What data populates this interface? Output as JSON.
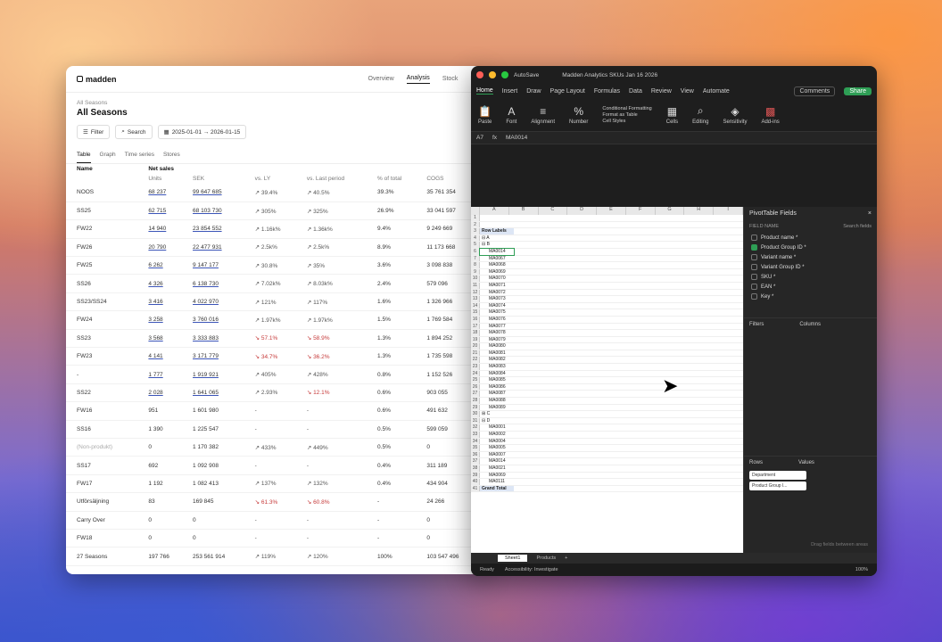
{
  "left": {
    "brand": "madden",
    "nav": [
      "Overview",
      "Analysis",
      "Stock",
      "P"
    ],
    "crumb": "All Seasons",
    "title": "All Seasons",
    "filter_label": "Filter",
    "search_label": "Search",
    "date_range": "2025-01-01 → 2026-01-15",
    "tabs": [
      "Table",
      "Graph",
      "Time series",
      "Stores"
    ],
    "header": {
      "name": "Name",
      "group": "Net sales",
      "units": "Units",
      "sek": "SEK",
      "vsly": "vs. LY",
      "vslp": "vs. Last period",
      "pct": "% of total",
      "cogs": "COGS"
    },
    "rows": [
      [
        "NOOS",
        "68 237",
        "99 647 685",
        "↗ 39.4%",
        "↗ 40.5%",
        "39.3%",
        "35 761 354"
      ],
      [
        "SS25",
        "62 715",
        "68 103 730",
        "↗ 305%",
        "↗ 325%",
        "26.9%",
        "33 041 597"
      ],
      [
        "FW22",
        "14 940",
        "23 854 552",
        "↗ 1.16k%",
        "↗ 1.36k%",
        "9.4%",
        "9 249 669"
      ],
      [
        "FW26",
        "20 790",
        "22 477 931",
        "↗ 2.5k%",
        "↗ 2.5k%",
        "8.9%",
        "11 173 668"
      ],
      [
        "FW25",
        "6 262",
        "9 147 177",
        "↗ 30.8%",
        "↗ 35%",
        "3.6%",
        "3 098 838"
      ],
      [
        "SS26",
        "4 326",
        "6 138 730",
        "↗ 7.02k%",
        "↗ 8.03k%",
        "2.4%",
        "579 096"
      ],
      [
        "SS23/SS24",
        "3 416",
        "4 022 970",
        "↗ 121%",
        "↗ 117%",
        "1.6%",
        "1 326 966"
      ],
      [
        "FW24",
        "3 258",
        "3 760 016",
        "↗ 1.97k%",
        "↗ 1.97k%",
        "1.5%",
        "1 769 584"
      ],
      [
        "SS23",
        "3 568",
        "3 333 883",
        "↘ 57.1%",
        "↘ 58.9%",
        "1.3%",
        "1 894 252"
      ],
      [
        "FW23",
        "4 141",
        "3 171 779",
        "↘ 34.7%",
        "↘ 36.2%",
        "1.3%",
        "1 735 598"
      ],
      [
        "-",
        "1 777",
        "1 919 921",
        "↗ 405%",
        "↗ 428%",
        "0.8%",
        "1 152 526"
      ],
      [
        "SS22",
        "2 028",
        "1 641 065",
        "↗ 2.93%",
        "↘ 12.1%",
        "0.6%",
        "903 055"
      ],
      [
        "FW16",
        "951",
        "1 601 980",
        "-",
        "-",
        "0.6%",
        "491 632"
      ],
      [
        "SS16",
        "1 390",
        "1 225 547",
        "-",
        "-",
        "0.5%",
        "599 059"
      ],
      [
        "(Non-produkt)",
        "0",
        "1 170 382",
        "↗ 433%",
        "↗ 449%",
        "0.5%",
        "0"
      ],
      [
        "SS17",
        "692",
        "1 092 908",
        "-",
        "-",
        "0.4%",
        "311 189"
      ],
      [
        "FW17",
        "1 192",
        "1 082 413",
        "↗ 137%",
        "↗ 132%",
        "0.4%",
        "434 904"
      ],
      [
        "Utförsäljning",
        "83",
        "169 845",
        "↘ 61.3%",
        "↘ 60.8%",
        "-",
        "24 266"
      ],
      [
        "Carry Over",
        "0",
        "0",
        "-",
        "-",
        "-",
        "0"
      ],
      [
        "FW18",
        "0",
        "0",
        "-",
        "-",
        "-",
        "0"
      ],
      [
        "27 Seasons",
        "197 766",
        "253 561 914",
        "↗ 119%",
        "↗ 120%",
        "100%",
        "103 547 496"
      ]
    ]
  },
  "right": {
    "autosave": "AutoSave",
    "doc_title": "Madden Analytics SKUs Jan 16 2026",
    "ribbon_tabs": [
      "Home",
      "Insert",
      "Draw",
      "Page Layout",
      "Formulas",
      "Data",
      "Review",
      "View",
      "Automate"
    ],
    "comments": "Comments",
    "share": "Share",
    "ribbon_groups": [
      "Paste",
      "Font",
      "Alignment",
      "Number",
      "Cells",
      "Editing",
      "Sensitivity",
      "Add-ins"
    ],
    "styles": [
      "Conditional Formatting",
      "Format as Table",
      "Cell Styles"
    ],
    "cell_ref": "A7",
    "formula": "MA0014",
    "columns": [
      "A",
      "B",
      "C",
      "D",
      "E",
      "F",
      "G",
      "H",
      "I"
    ],
    "grid_rows": [
      "",
      "",
      "Row Labels",
      "⊟ A",
      "⊟ B",
      "MA0014",
      "MA0067",
      "MA0068",
      "MA0069",
      "MA0070",
      "MA0071",
      "MA0072",
      "MA0073",
      "MA0074",
      "MA0075",
      "MA0076",
      "MA0077",
      "MA0078",
      "MA0079",
      "MA0080",
      "MA0081",
      "MA0082",
      "MA0083",
      "MA0084",
      "MA0085",
      "MA0086",
      "MA0087",
      "MA0088",
      "MA0089",
      "⊞ C",
      "⊟ D",
      "MA0001",
      "MA0002",
      "MA0004",
      "MA0005",
      "MA0007",
      "MA0014",
      "MA0021",
      "MA0069",
      "MA0111",
      "Grand Total"
    ],
    "pivot_title": "PivotTable Fields",
    "field_name": "FIELD NAME",
    "search_fields": "Search fields",
    "fields": [
      {
        "name": "Product name *",
        "checked": false
      },
      {
        "name": "Product Group ID *",
        "checked": true
      },
      {
        "name": "Variant name *",
        "checked": false
      },
      {
        "name": "Variant Group ID *",
        "checked": false
      },
      {
        "name": "SKU *",
        "checked": false
      },
      {
        "name": "EAN *",
        "checked": false
      },
      {
        "name": "Key *",
        "checked": false
      }
    ],
    "filters": "Filters",
    "columns_label": "Columns",
    "rows_label": "Rows",
    "values": "Values",
    "row_pills": [
      "Department",
      "Product Group I..."
    ],
    "drag_hint": "Drag fields between areas",
    "sheets": [
      "Sheet1",
      "Products"
    ],
    "status_ready": "Ready",
    "accessibility": "Accessibility: Investigate",
    "zoom": "100%"
  }
}
